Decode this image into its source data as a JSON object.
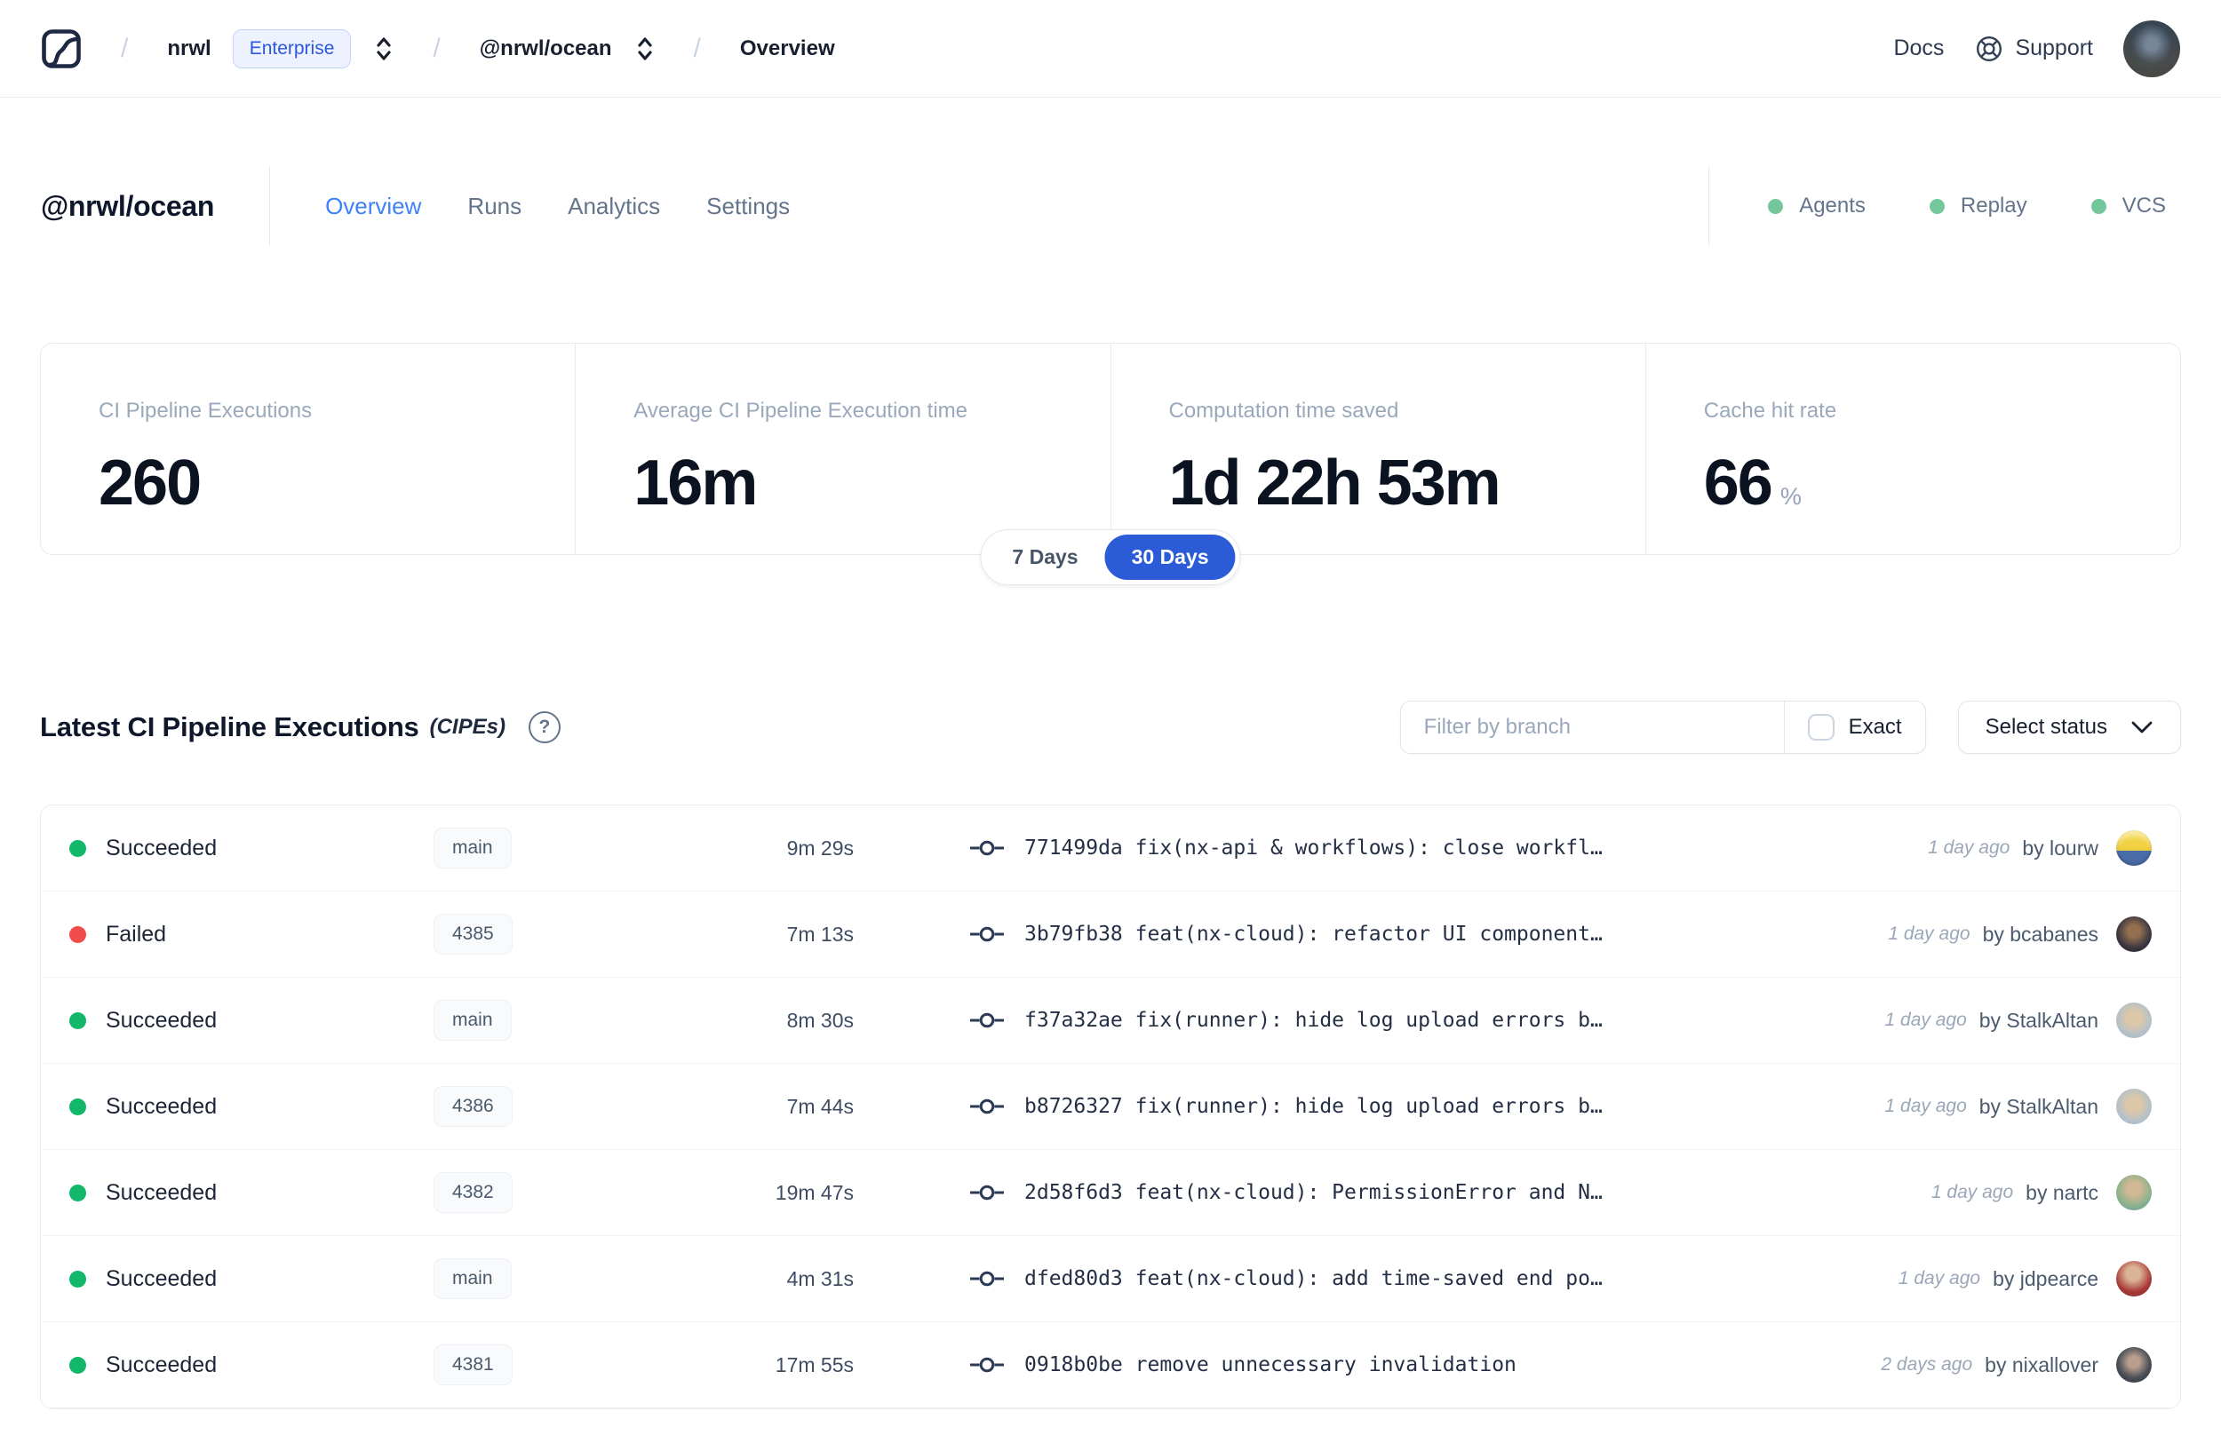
{
  "header": {
    "breadcrumb": {
      "org": "nrwl",
      "org_badge": "Enterprise",
      "workspace": "@nrwl/ocean",
      "page": "Overview"
    },
    "docs_label": "Docs",
    "support_label": "Support"
  },
  "workspace": {
    "title": "@nrwl/ocean",
    "tabs": [
      {
        "label": "Overview",
        "active": true
      },
      {
        "label": "Runs",
        "active": false
      },
      {
        "label": "Analytics",
        "active": false
      },
      {
        "label": "Settings",
        "active": false
      }
    ],
    "connections": [
      {
        "label": "Agents",
        "status": "online"
      },
      {
        "label": "Replay",
        "status": "online"
      },
      {
        "label": "VCS",
        "status": "online"
      }
    ]
  },
  "stats": {
    "cards": [
      {
        "label": "CI Pipeline Executions",
        "value": "260",
        "suffix": ""
      },
      {
        "label": "Average CI Pipeline Execution time",
        "value": "16m",
        "suffix": ""
      },
      {
        "label": "Computation time saved",
        "value": "1d 22h 53m",
        "suffix": ""
      },
      {
        "label": "Cache hit rate",
        "value": "66",
        "suffix": "%"
      }
    ],
    "range_toggle": {
      "options": [
        "7 Days",
        "30 Days"
      ],
      "selected": "30 Days"
    }
  },
  "cipes": {
    "title": "Latest CI Pipeline Executions",
    "title_suffix": "(CIPEs)",
    "filter": {
      "branch_placeholder": "Filter by branch",
      "exact_label": "Exact",
      "status_dropdown_label": "Select status"
    },
    "rows": [
      {
        "status": "Succeeded",
        "status_color": "green",
        "branch": "main",
        "duration": "9m 29s",
        "commit": "771499da fix(nx-api & workflows): close workfl…",
        "time": "1 day ago",
        "author": "by lourw"
      },
      {
        "status": "Failed",
        "status_color": "red",
        "branch": "4385",
        "duration": "7m 13s",
        "commit": "3b79fb38 feat(nx-cloud): refactor UI component…",
        "time": "1 day ago",
        "author": "by bcabanes"
      },
      {
        "status": "Succeeded",
        "status_color": "green",
        "branch": "main",
        "duration": "8m 30s",
        "commit": "f37a32ae fix(runner): hide log upload errors b…",
        "time": "1 day ago",
        "author": "by StalkAltan"
      },
      {
        "status": "Succeeded",
        "status_color": "green",
        "branch": "4386",
        "duration": "7m 44s",
        "commit": "b8726327 fix(runner): hide log upload errors b…",
        "time": "1 day ago",
        "author": "by StalkAltan"
      },
      {
        "status": "Succeeded",
        "status_color": "green",
        "branch": "4382",
        "duration": "19m 47s",
        "commit": "2d58f6d3 feat(nx-cloud): PermissionError and N…",
        "time": "1 day ago",
        "author": "by nartc"
      },
      {
        "status": "Succeeded",
        "status_color": "green",
        "branch": "main",
        "duration": "4m 31s",
        "commit": "dfed80d3 feat(nx-cloud): add time-saved end po…",
        "time": "1 day ago",
        "author": "by jdpearce"
      },
      {
        "status": "Succeeded",
        "status_color": "green",
        "branch": "4381",
        "duration": "17m 55s",
        "commit": "0918b0be remove unnecessary invalidation",
        "time": "2 days ago",
        "author": "by nixallover"
      }
    ]
  },
  "colors": {
    "accent_blue": "#2b5bd7",
    "tab_active_blue": "#3d82f6",
    "success_green": "#12b76a",
    "failed_red": "#f14c4c",
    "connection_green": "#74c79b"
  }
}
